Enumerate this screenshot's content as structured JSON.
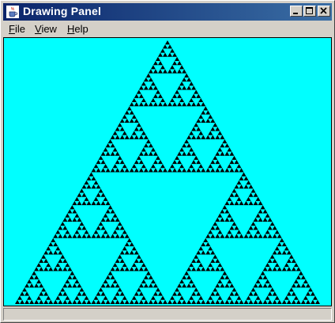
{
  "window": {
    "title": "Drawing Panel",
    "controls": {
      "minimize": "minimize",
      "maximize": "maximize",
      "close": "close"
    }
  },
  "menu": [
    {
      "mnemonic": "F",
      "rest": "ile"
    },
    {
      "mnemonic": "V",
      "rest": "iew"
    },
    {
      "mnemonic": "H",
      "rest": "elp"
    }
  ],
  "panel": {
    "background": "#00ffff",
    "fill_color": "#000000",
    "recursion_depth": 6
  },
  "status": {
    "text": ""
  }
}
